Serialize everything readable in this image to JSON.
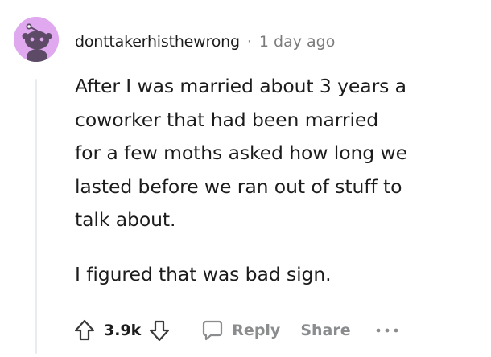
{
  "comment": {
    "author": "donttakerhisthewrong",
    "separator": "·",
    "timestamp": "1 day ago",
    "avatar_color": "#dfa8ef",
    "paragraphs": [
      [
        "After I was married about 3 years a",
        "coworker that had been married",
        "for a few moths asked how long we",
        "lasted before we ran out of stuff to",
        "talk about."
      ],
      [
        "I figured that was bad sign."
      ]
    ]
  },
  "actions": {
    "upvote_icon": "arrow-up-outline-icon",
    "score": "3.9k",
    "downvote_icon": "arrow-down-outline-icon",
    "reply_icon": "speech-bubble-icon",
    "reply_label": "Reply",
    "share_label": "Share",
    "more_icon": "ellipsis-icon"
  }
}
